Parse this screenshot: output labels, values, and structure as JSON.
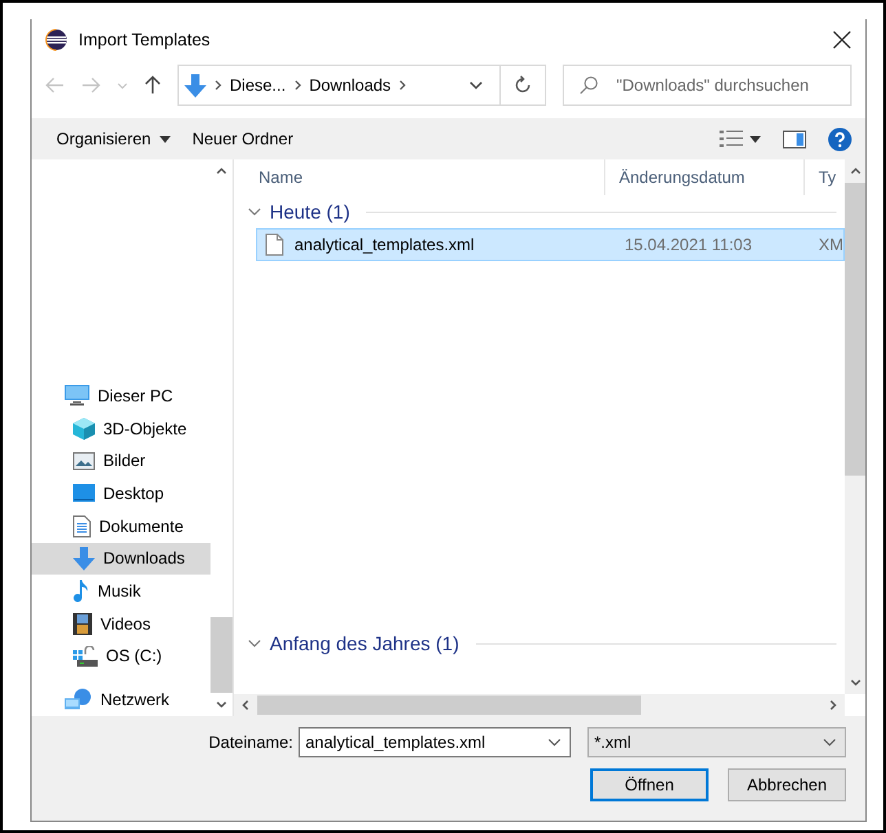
{
  "window": {
    "title": "Import Templates"
  },
  "address": {
    "crumbs": [
      "Diese...",
      "Downloads"
    ]
  },
  "search": {
    "placeholder": "\"Downloads\" durchsuchen"
  },
  "toolbar": {
    "organize": "Organisieren",
    "new_folder": "Neuer Ordner"
  },
  "sidebar": {
    "items": [
      {
        "label": "Dieser PC",
        "kind": "pc",
        "selected": false,
        "children": [
          {
            "label": "3D-Objekte",
            "kind": "cube",
            "selected": false
          },
          {
            "label": "Bilder",
            "kind": "pictures",
            "selected": false
          },
          {
            "label": "Desktop",
            "kind": "desktop",
            "selected": false
          },
          {
            "label": "Dokumente",
            "kind": "document",
            "selected": false
          },
          {
            "label": "Downloads",
            "kind": "download",
            "selected": true
          },
          {
            "label": "Musik",
            "kind": "music",
            "selected": false
          },
          {
            "label": "Videos",
            "kind": "film",
            "selected": false
          },
          {
            "label": "OS (C:)",
            "kind": "drive",
            "selected": false
          }
        ]
      },
      {
        "label": "Netzwerk",
        "kind": "network",
        "selected": false
      }
    ]
  },
  "columns": [
    "Name",
    "Änderungsdatum",
    "Ty"
  ],
  "groups": [
    {
      "label": "Heute (1)",
      "expanded": true,
      "files": [
        {
          "name": "analytical_templates.xml",
          "date": "15.04.2021 11:03",
          "type": "XM",
          "selected": true
        }
      ]
    },
    {
      "label": "Anfang des Jahres (1)",
      "expanded": true
    }
  ],
  "filename": {
    "label": "Dateiname:",
    "value": "analytical_templates.xml"
  },
  "filter": {
    "value": "*.xml"
  },
  "buttons": [
    {
      "label": "Öffnen",
      "default": true
    },
    {
      "label": "Abbrechen",
      "default": false
    }
  ]
}
